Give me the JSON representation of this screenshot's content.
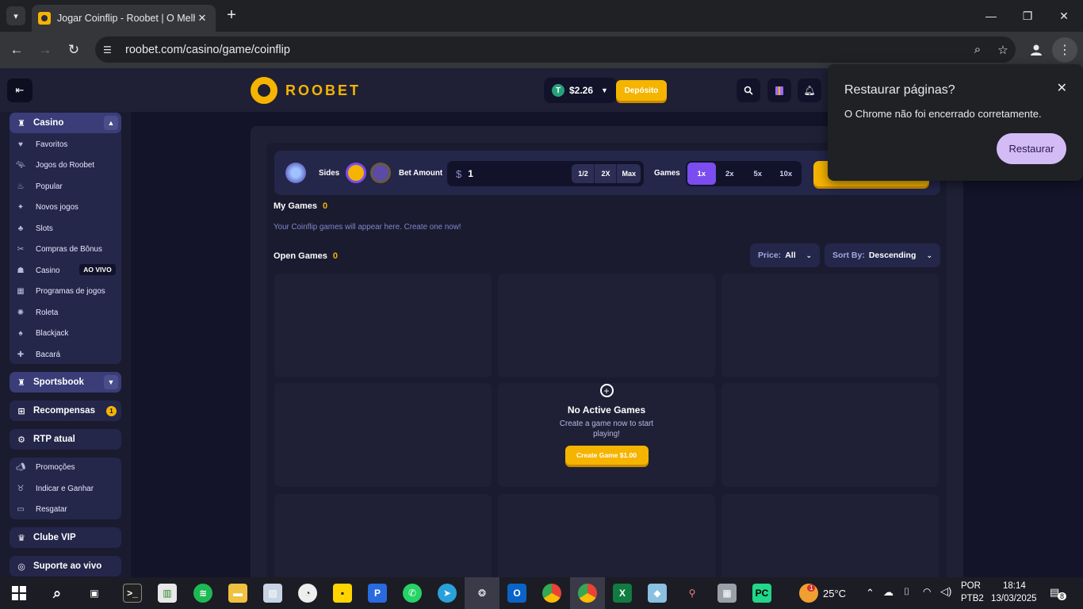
{
  "browser": {
    "tab_title": "Jogar Coinflip - Roobet | O Melh",
    "new_tab": "+",
    "url": "roobet.com/casino/game/coinflip",
    "window_controls": [
      "minimize-icon",
      "restore-icon",
      "close-icon"
    ]
  },
  "header": {
    "logo_text": "ROOBET",
    "balance": "$2.26",
    "coin_symbol": "T",
    "deposit_label": "Depósito"
  },
  "sidebar": {
    "casino_label": "Casino",
    "casino_items": [
      {
        "label": "Favoritos",
        "icon": "heart-icon"
      },
      {
        "label": "Jogos do Roobet",
        "icon": "kangaroo-icon"
      },
      {
        "label": "Popular",
        "icon": "flame-icon"
      },
      {
        "label": "Novos jogos",
        "icon": "sparkle-icon"
      },
      {
        "label": "Slots",
        "icon": "cherry-icon"
      },
      {
        "label": "Compras de Bônus",
        "icon": "bonus-icon"
      },
      {
        "label": "Casino",
        "icon": "live-casino-icon"
      },
      {
        "label": "Programas de jogos",
        "icon": "gameshow-icon"
      },
      {
        "label": "Roleta",
        "icon": "roulette-icon"
      },
      {
        "label": "Blackjack",
        "icon": "spade-icon"
      },
      {
        "label": "Bacará",
        "icon": "club-icon"
      }
    ],
    "live_badge": "AO VIVO",
    "sportsbook_label": "Sportsbook",
    "rewards_label": "Recompensas",
    "rewards_count": "1",
    "rtp_label": "RTP atual",
    "promo_items": [
      {
        "label": "Promoções",
        "icon": "megaphone-icon"
      },
      {
        "label": "Indicar e Ganhar",
        "icon": "money-bag-icon"
      },
      {
        "label": "Resgatar",
        "icon": "ticket-icon"
      }
    ],
    "vip_label": "Clube VIP",
    "support_label": "Suporte ao vivo"
  },
  "game": {
    "sides_label": "Sides",
    "bet_amount_label": "Bet Amount",
    "bet_currency": "$",
    "bet_value": "1",
    "bet_buttons": [
      "1/2",
      "2X",
      "Max"
    ],
    "games_label": "Games",
    "games_options": [
      "1x",
      "2x",
      "5x",
      "10x"
    ],
    "games_selected": "1x",
    "my_games_label": "My Games",
    "my_games_count": "0",
    "my_games_empty": "Your Coinflip games will appear here. Create one now!",
    "open_games_label": "Open Games",
    "open_games_count": "0",
    "price_filter_label": "Price:",
    "price_filter_value": "All",
    "sort_label": "Sort By:",
    "sort_value": "Descending",
    "empty_title": "No Active Games",
    "empty_subtitle": "Create a game now to start playing!",
    "create_game_label": "Create Game $1.00"
  },
  "restore_popup": {
    "title": "Restaurar páginas?",
    "message": "O Chrome não foi encerrado corretamente.",
    "button": "Restaurar"
  },
  "taskbar": {
    "weather_temp": "25°C",
    "weather_badge": "1",
    "language": "POR",
    "layout": "PTB2",
    "time": "18:14",
    "date": "13/03/2025",
    "notifications": "8"
  },
  "colors": {
    "accent": "#f5b400",
    "purple": "#7b4cf0",
    "panel": "#24264a",
    "background": "#1a1b2f"
  }
}
